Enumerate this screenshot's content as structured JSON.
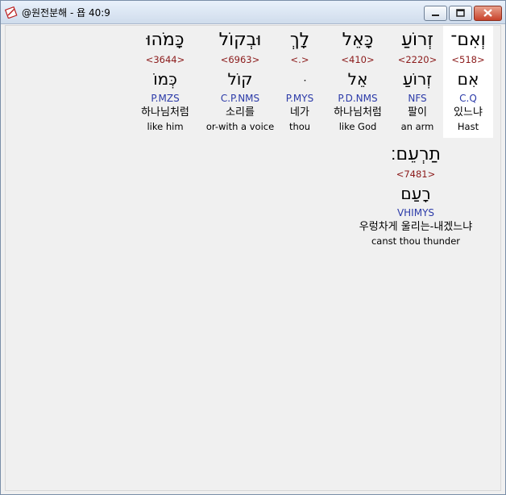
{
  "window": {
    "title": "@원전분해 - 욥 40:9",
    "icon": "bible-app-icon",
    "buttons": {
      "minimize": "minimize-icon",
      "maximize": "maximize-icon",
      "close": "close-icon"
    }
  },
  "words": [
    {
      "hebrew": "וְאִם־",
      "strong": "<518>",
      "lemma": "אִם",
      "morph": "C.Q",
      "korean": "있느냐",
      "english": "Hast",
      "selected": true
    },
    {
      "hebrew": "זְרוֹעַ",
      "strong": "<2220>",
      "lemma": "זְרוֹעַ",
      "morph": "NFS",
      "korean": "팔이",
      "english": "an arm",
      "selected": false
    },
    {
      "hebrew": "כָּאֵל",
      "strong": "<410>",
      "lemma": "אֵל",
      "morph": "P.D.NMS",
      "korean": "하나님처럼",
      "english": "like God",
      "selected": false
    },
    {
      "hebrew": "לָךְ",
      "strong": "<.>",
      "lemma": "ּ",
      "morph": "P.MYS",
      "korean": "네가",
      "english": "thou",
      "selected": false
    },
    {
      "hebrew": "וּבְקוֹל",
      "strong": "<6963>",
      "lemma": "קוֹל",
      "morph": "C.P.NMS",
      "korean": "소리를",
      "english": "or-with a voice",
      "selected": false
    },
    {
      "hebrew": "כָּמֹהוּ",
      "strong": "<3644>",
      "lemma": "כְּמוֹ",
      "morph": "P.MZS",
      "korean": "하나님처럼",
      "english": "like him",
      "selected": false
    },
    {
      "hebrew": "תַרְעֵם׃",
      "strong": "<7481>",
      "lemma": "רָעַם",
      "morph": "VHIMYS",
      "korean": "우렁차게 울리는-내겠느냐",
      "english": "canst thou thunder",
      "selected": false
    }
  ]
}
